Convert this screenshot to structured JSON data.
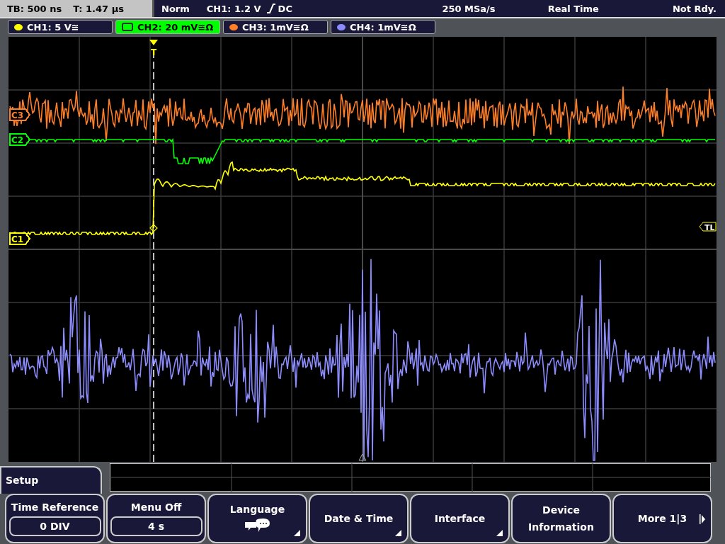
{
  "status_bar": {
    "timebase": "TB: 500 ns",
    "trigger_time": "T: 1.47 µs",
    "trigger_mode": "Norm",
    "trigger_source": "CH1: 1.2 V",
    "trigger_coupling": "DC",
    "sample_rate": "250 MSa/s",
    "acquisition": "Real Time",
    "state": "Not Rdy."
  },
  "channels": [
    {
      "label": "CH1: 5 V≅",
      "color": "#ffff00",
      "selected": false
    },
    {
      "label": "CH2: 20 mV≅Ω",
      "color": "#00ff00",
      "selected": true
    },
    {
      "label": "CH3: 1mV≅Ω",
      "color": "#ff7f27",
      "selected": false
    },
    {
      "label": "CH4: 1mV≅Ω",
      "color": "#8c8cff",
      "selected": false
    }
  ],
  "trace_markers": [
    {
      "label": "C3",
      "color": "#ff7f27"
    },
    {
      "label": "C2",
      "color": "#00ff00"
    },
    {
      "label": "C1",
      "color": "#ffff00"
    }
  ],
  "trigger_marker": "T",
  "trigger_level_marker": "TL",
  "menu": {
    "title": "Setup",
    "buttons": [
      {
        "kind": "value",
        "label": "Time Reference",
        "value": "0 DIV"
      },
      {
        "kind": "value",
        "label": "Menu Off",
        "value": "4 s"
      },
      {
        "kind": "icon",
        "label": "Language",
        "submenu": true
      },
      {
        "kind": "plain",
        "label": "Date & Time",
        "submenu": true
      },
      {
        "kind": "plain",
        "label": "Interface",
        "submenu": true
      },
      {
        "kind": "plain",
        "label": "Device Information",
        "submenu": false
      },
      {
        "kind": "next",
        "label": "More 1|3",
        "submenu": false
      }
    ]
  }
}
